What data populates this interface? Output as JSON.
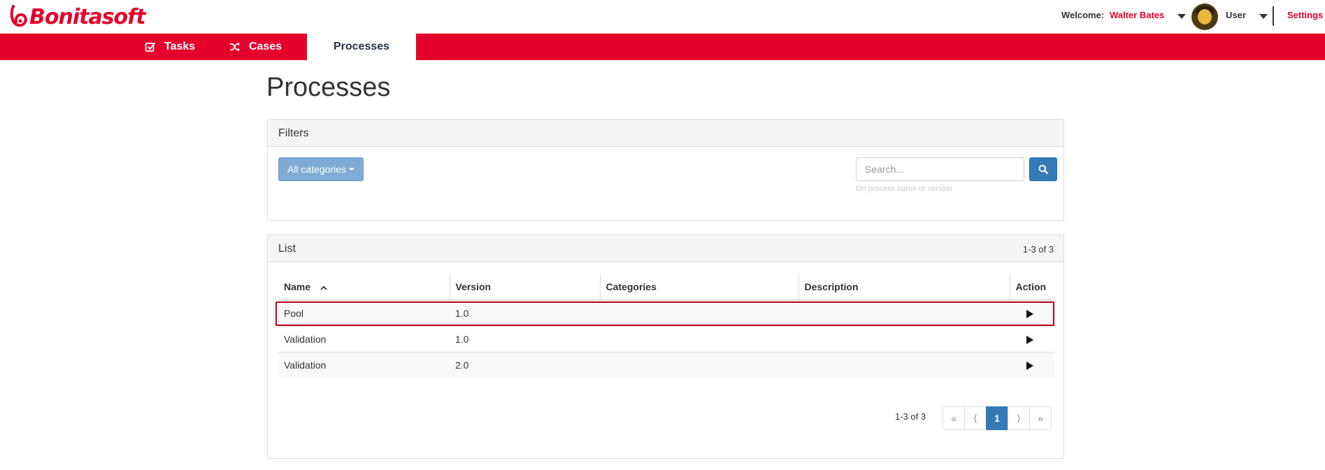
{
  "header": {
    "logo_text": "Bonitasoft",
    "welcome_label": "Welcome:",
    "user_name": "Walter Bates",
    "profile_label": "User",
    "settings_label": "Settings"
  },
  "nav": {
    "tabs": [
      {
        "label": "Tasks",
        "icon": "checkbox-icon"
      },
      {
        "label": "Cases",
        "icon": "shuffle-icon"
      },
      {
        "label": "Processes",
        "active": true
      }
    ]
  },
  "page": {
    "title": "Processes"
  },
  "filters": {
    "title": "Filters",
    "category_button": "All categories",
    "search_placeholder": "Search...",
    "search_help": "On process name or version"
  },
  "list": {
    "title": "List",
    "count": "1-3 of 3",
    "columns": [
      "Name",
      "Version",
      "Categories",
      "Description",
      "Action"
    ],
    "rows": [
      {
        "name": "Pool",
        "version": "1.0",
        "categories": "",
        "description": "",
        "highlighted": true
      },
      {
        "name": "Validation",
        "version": "1.0",
        "categories": "",
        "description": ""
      },
      {
        "name": "Validation",
        "version": "2.0",
        "categories": "",
        "description": ""
      }
    ],
    "pager_info": "1-3 of 3",
    "pager": {
      "first": "«",
      "prev": "⟨",
      "current": "1",
      "next": "⟩",
      "last": "»"
    }
  },
  "colors": {
    "brand": "#e4002b",
    "primary": "#337ab7"
  }
}
